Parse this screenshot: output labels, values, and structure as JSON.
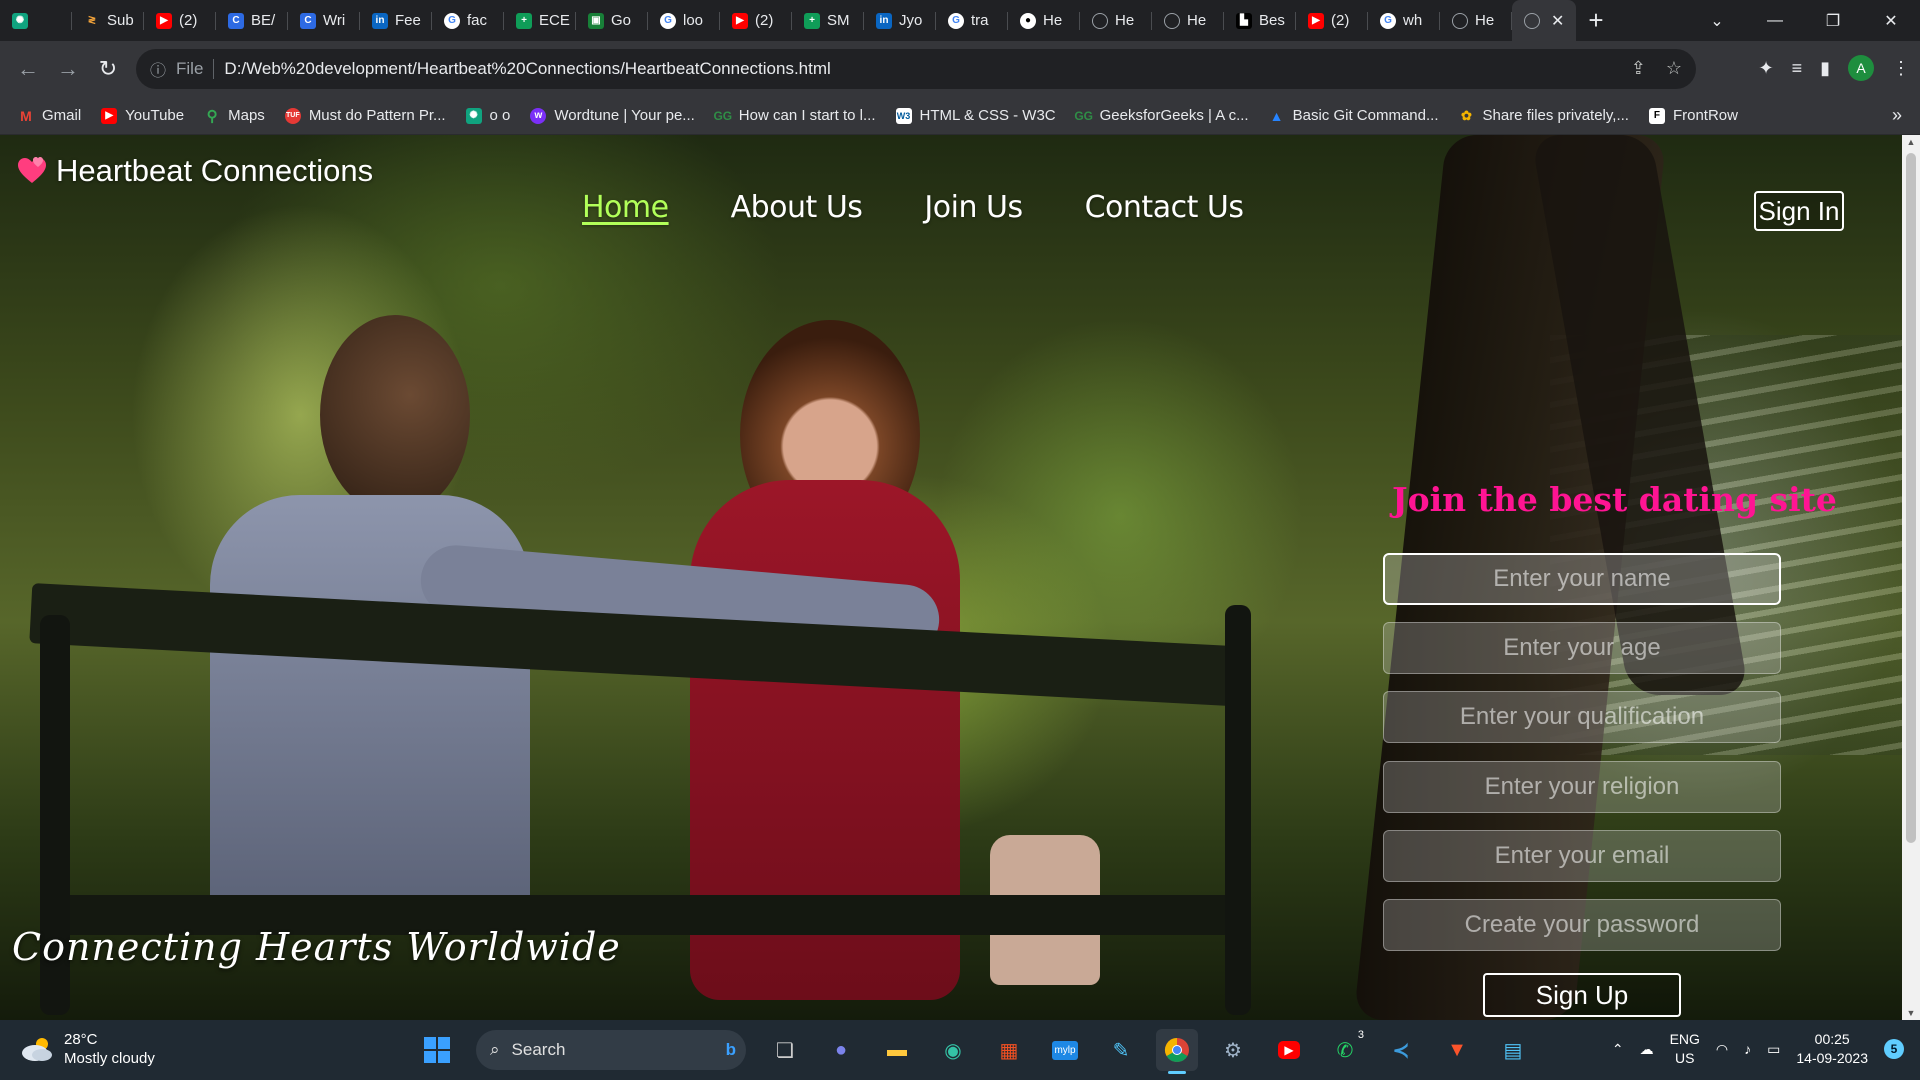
{
  "browser": {
    "tabs": [
      {
        "label": "",
        "icon": "chatgpt-icon",
        "color": "#10a37f"
      },
      {
        "label": "Sub",
        "icon": "subscript-icon",
        "color": "#f2a33a"
      },
      {
        "label": "(2)",
        "icon": "youtube-icon",
        "color": "#ff0000"
      },
      {
        "label": "BE/",
        "icon": "c-icon",
        "color": "#2d6ae3"
      },
      {
        "label": "Wri",
        "icon": "c-icon",
        "color": "#2d6ae3"
      },
      {
        "label": "Fee",
        "icon": "linkedin-icon",
        "color": "#0a66c2"
      },
      {
        "label": "fac",
        "icon": "google-icon",
        "color": "#ffffff"
      },
      {
        "label": "ECE",
        "icon": "plus-icon",
        "color": "#0f9d58"
      },
      {
        "label": "Go",
        "icon": "classroom-icon",
        "color": "#188038"
      },
      {
        "label": "loo",
        "icon": "google-icon",
        "color": "#ffffff"
      },
      {
        "label": "(2)",
        "icon": "youtube-icon",
        "color": "#ff0000"
      },
      {
        "label": "SM",
        "icon": "plus-icon",
        "color": "#0f9d58"
      },
      {
        "label": "Jyo",
        "icon": "linkedin-icon",
        "color": "#0a66c2"
      },
      {
        "label": "tra",
        "icon": "google-icon",
        "color": "#ffffff"
      },
      {
        "label": "He",
        "icon": "github-icon",
        "color": "#ffffff"
      },
      {
        "label": "He",
        "icon": "globe-icon",
        "color": "#9aa0a6"
      },
      {
        "label": "He",
        "icon": "globe-icon",
        "color": "#9aa0a6"
      },
      {
        "label": "Bes",
        "icon": "site-icon",
        "color": "#000000"
      },
      {
        "label": "(2)",
        "icon": "youtube-icon",
        "color": "#ff0000"
      },
      {
        "label": "wh",
        "icon": "google-icon",
        "color": "#ffffff"
      },
      {
        "label": "He",
        "icon": "globe-icon",
        "color": "#9aa0a6"
      }
    ],
    "active_tab": {
      "label": "",
      "icon": "globe-icon"
    },
    "address": {
      "scheme_label": "File",
      "url": "D:/Web%20development/Heartbeat%20Connections/HeartbeatConnections.html"
    },
    "profile_initial": "A",
    "bookmarks": [
      {
        "label": "Gmail",
        "icon": "gmail-icon",
        "color": "#ea4335"
      },
      {
        "label": "YouTube",
        "icon": "youtube-icon",
        "color": "#ff0000"
      },
      {
        "label": "Maps",
        "icon": "maps-icon",
        "color": "#34a853"
      },
      {
        "label": "Must do Pattern Pr...",
        "icon": "tuf-icon",
        "color": "#e53935"
      },
      {
        "label": "o o",
        "icon": "chatgpt-icon",
        "color": "#10a37f"
      },
      {
        "label": "Wordtune | Your pe...",
        "icon": "wordtune-icon",
        "color": "#7b2ff7"
      },
      {
        "label": "How can I start to l...",
        "icon": "gfg-icon",
        "color": "#2f8d46"
      },
      {
        "label": "HTML & CSS - W3C",
        "icon": "w3c-icon",
        "color": "#ffffff"
      },
      {
        "label": "GeeksforGeeks | A c...",
        "icon": "gfg-icon",
        "color": "#2f8d46"
      },
      {
        "label": "Basic Git Command...",
        "icon": "atlassian-icon",
        "color": "#2684ff"
      },
      {
        "label": "Share files privately,...",
        "icon": "share-icon",
        "color": "#f4b400"
      },
      {
        "label": "FrontRow",
        "icon": "frontrow-icon",
        "color": "#ffffff"
      }
    ]
  },
  "site": {
    "brand": "Heartbeat Connections",
    "nav": [
      {
        "label": "Home",
        "active": true
      },
      {
        "label": "About Us",
        "active": false
      },
      {
        "label": "Join Us",
        "active": false
      },
      {
        "label": "Contact Us",
        "active": false
      }
    ],
    "signin_label": "Sign In",
    "form": {
      "title": "Join the best dating site",
      "fields": [
        {
          "placeholder": "Enter your name"
        },
        {
          "placeholder": "Enter your age"
        },
        {
          "placeholder": "Enter your qualification"
        },
        {
          "placeholder": "Enter your religion"
        },
        {
          "placeholder": "Enter your email"
        },
        {
          "placeholder": "Create your password"
        }
      ],
      "submit_label": "Sign Up"
    },
    "tagline": "Connecting Hearts Worldwide",
    "colors": {
      "title": "#ff1493",
      "active_nav": "#b2ff59"
    }
  },
  "taskbar": {
    "weather": {
      "temp": "28°C",
      "condition": "Mostly cloudy"
    },
    "search_label": "Search",
    "apps": [
      {
        "name": "task-view",
        "icon": "task-view-icon"
      },
      {
        "name": "teams",
        "icon": "teams-icon"
      },
      {
        "name": "file-explorer",
        "icon": "folder-icon"
      },
      {
        "name": "edge",
        "icon": "edge-icon"
      },
      {
        "name": "store",
        "icon": "store-icon"
      },
      {
        "name": "mylp",
        "icon": "mylp-icon"
      },
      {
        "name": "paint",
        "icon": "paint-icon"
      },
      {
        "name": "chrome",
        "icon": "chrome-icon",
        "active": true
      },
      {
        "name": "settings",
        "icon": "gear-icon"
      },
      {
        "name": "youtube",
        "icon": "youtube-icon"
      },
      {
        "name": "whatsapp",
        "icon": "whatsapp-icon",
        "badge": "3"
      },
      {
        "name": "vscode",
        "icon": "vscode-icon"
      },
      {
        "name": "brave",
        "icon": "brave-icon"
      },
      {
        "name": "notepad",
        "icon": "notepad-icon"
      }
    ],
    "language": {
      "line1": "ENG",
      "line2": "US"
    },
    "clock": {
      "time": "00:25",
      "date": "14-09-2023"
    },
    "notification_count": "5"
  }
}
